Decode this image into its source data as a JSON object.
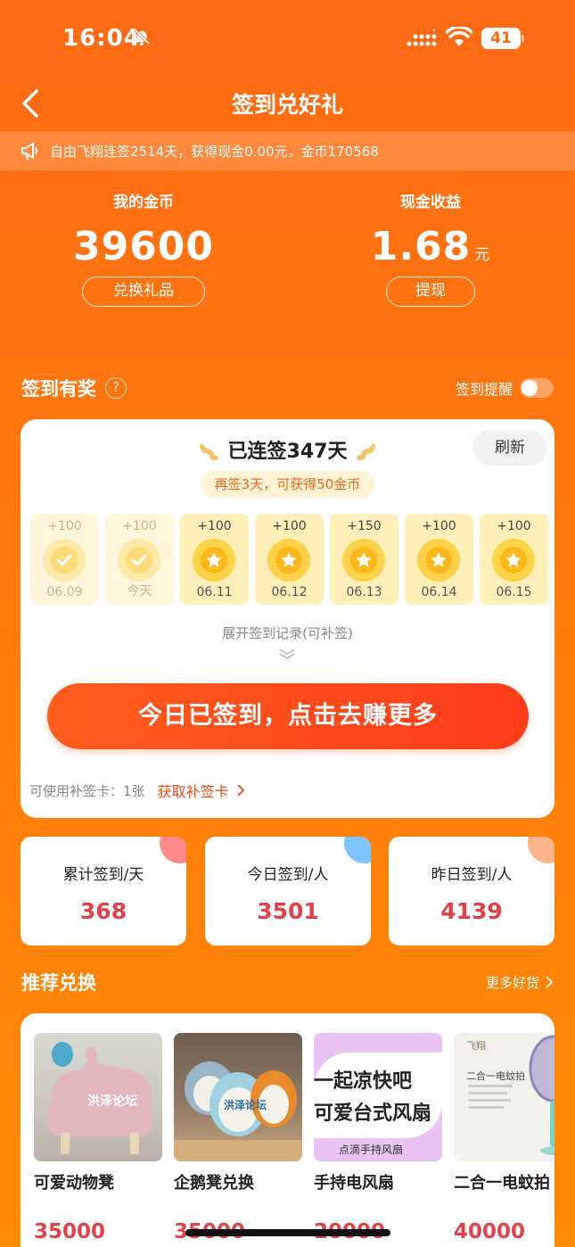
{
  "status_bar": {
    "time": "16:04",
    "battery": "41"
  },
  "nav": {
    "title": "签到兑好礼"
  },
  "notice": {
    "text": "自由飞翔连签2514天，获得现金0.00元，金币170568"
  },
  "coins": {
    "label": "我的金币",
    "value": "39600",
    "button": "兑换礼品"
  },
  "cash": {
    "label": "现金收益",
    "value": "1.68",
    "unit": "元",
    "button": "提现"
  },
  "checkin": {
    "section_title": "签到有奖",
    "help": "?",
    "reminder_label": "签到提醒",
    "streak_text": "已连签347天",
    "refresh_label": "刷新",
    "hint": "再签3天，可获得50金币",
    "days": [
      {
        "points": "+100",
        "date": "06.09",
        "status": "signed"
      },
      {
        "points": "+100",
        "date": "今天",
        "status": "signed"
      },
      {
        "points": "+100",
        "date": "06.11",
        "status": "upcoming"
      },
      {
        "points": "+100",
        "date": "06.12",
        "status": "upcoming"
      },
      {
        "points": "+150",
        "date": "06.13",
        "status": "upcoming"
      },
      {
        "points": "+100",
        "date": "06.14",
        "status": "upcoming"
      },
      {
        "points": "+100",
        "date": "06.15",
        "status": "upcoming"
      }
    ],
    "expand_label": "展开签到记录(可补签)",
    "main_button": "今日已签到，点击去赚更多",
    "makeup_label": "可使用补签卡：1张",
    "makeup_link": "获取补签卡"
  },
  "stats": [
    {
      "label": "累计签到/天",
      "value": "368",
      "corner_color": "#FF8A8A"
    },
    {
      "label": "今日签到/人",
      "value": "3501",
      "corner_color": "#7FC4FF"
    },
    {
      "label": "昨日签到/人",
      "value": "4139",
      "corner_color": "#FFB48A"
    }
  ],
  "recommend": {
    "title": "推荐兑换",
    "more_label": "更多好货",
    "products": [
      {
        "name": "可爱动物凳",
        "price": "35000",
        "img_text": "洪泽论坛"
      },
      {
        "name": "企鹅凳兑换",
        "price": "35000",
        "img_text": "洪泽论坛"
      },
      {
        "name": "手持电风扇",
        "price": "20000",
        "img_line1": "一起凉快吧",
        "img_line2": "可爱台式风扇",
        "img_line3": "点滴手持风扇"
      },
      {
        "name": "二合一电蚊拍",
        "price": "40000",
        "img_text": "二合一电蚊拍",
        "img_brand": "飞翔"
      }
    ]
  },
  "colors": {
    "primary": "#FF6A14",
    "accent_red": "#E0424C",
    "button": "#FF4A1A"
  }
}
